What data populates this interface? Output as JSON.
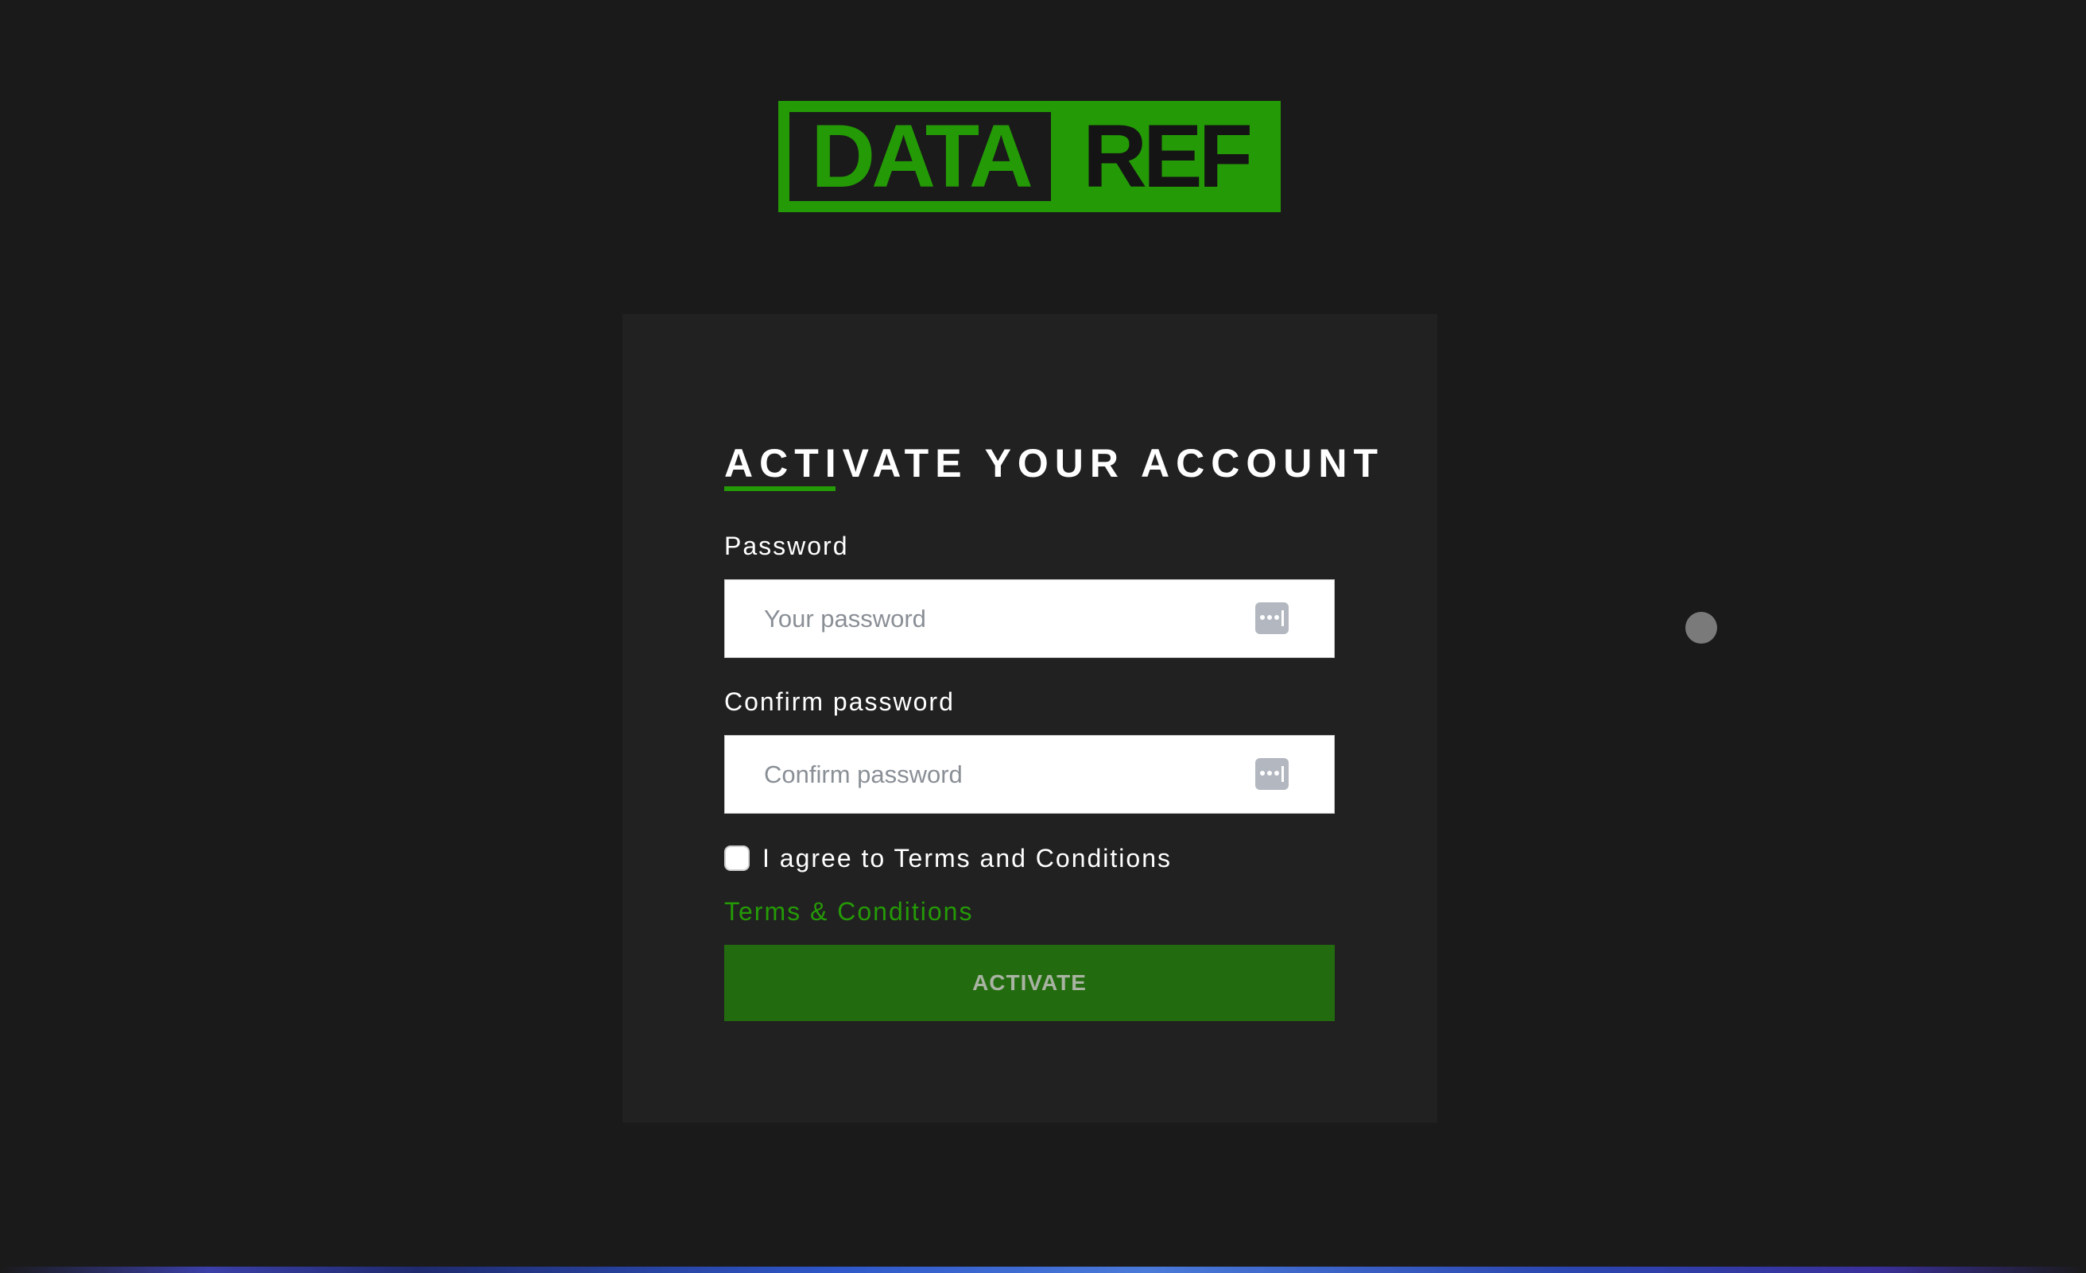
{
  "logo": {
    "left_text": "DATA",
    "right_text": "REF"
  },
  "form": {
    "title": "ACTIVATE YOUR ACCOUNT",
    "password_label": "Password",
    "password_placeholder": "Your password",
    "confirm_label": "Confirm password",
    "confirm_placeholder": "Confirm password",
    "terms_checkbox_label": "I agree to Terms and Conditions",
    "terms_checked": false,
    "terms_link": "Terms & Conditions",
    "activate_button": "ACTIVATE",
    "password_toggle_icon": "password-dots-icon"
  },
  "colors": {
    "background": "#1a1a1a",
    "card": "#212121",
    "accent_green": "#249a06",
    "button_green": "#226b0e"
  }
}
